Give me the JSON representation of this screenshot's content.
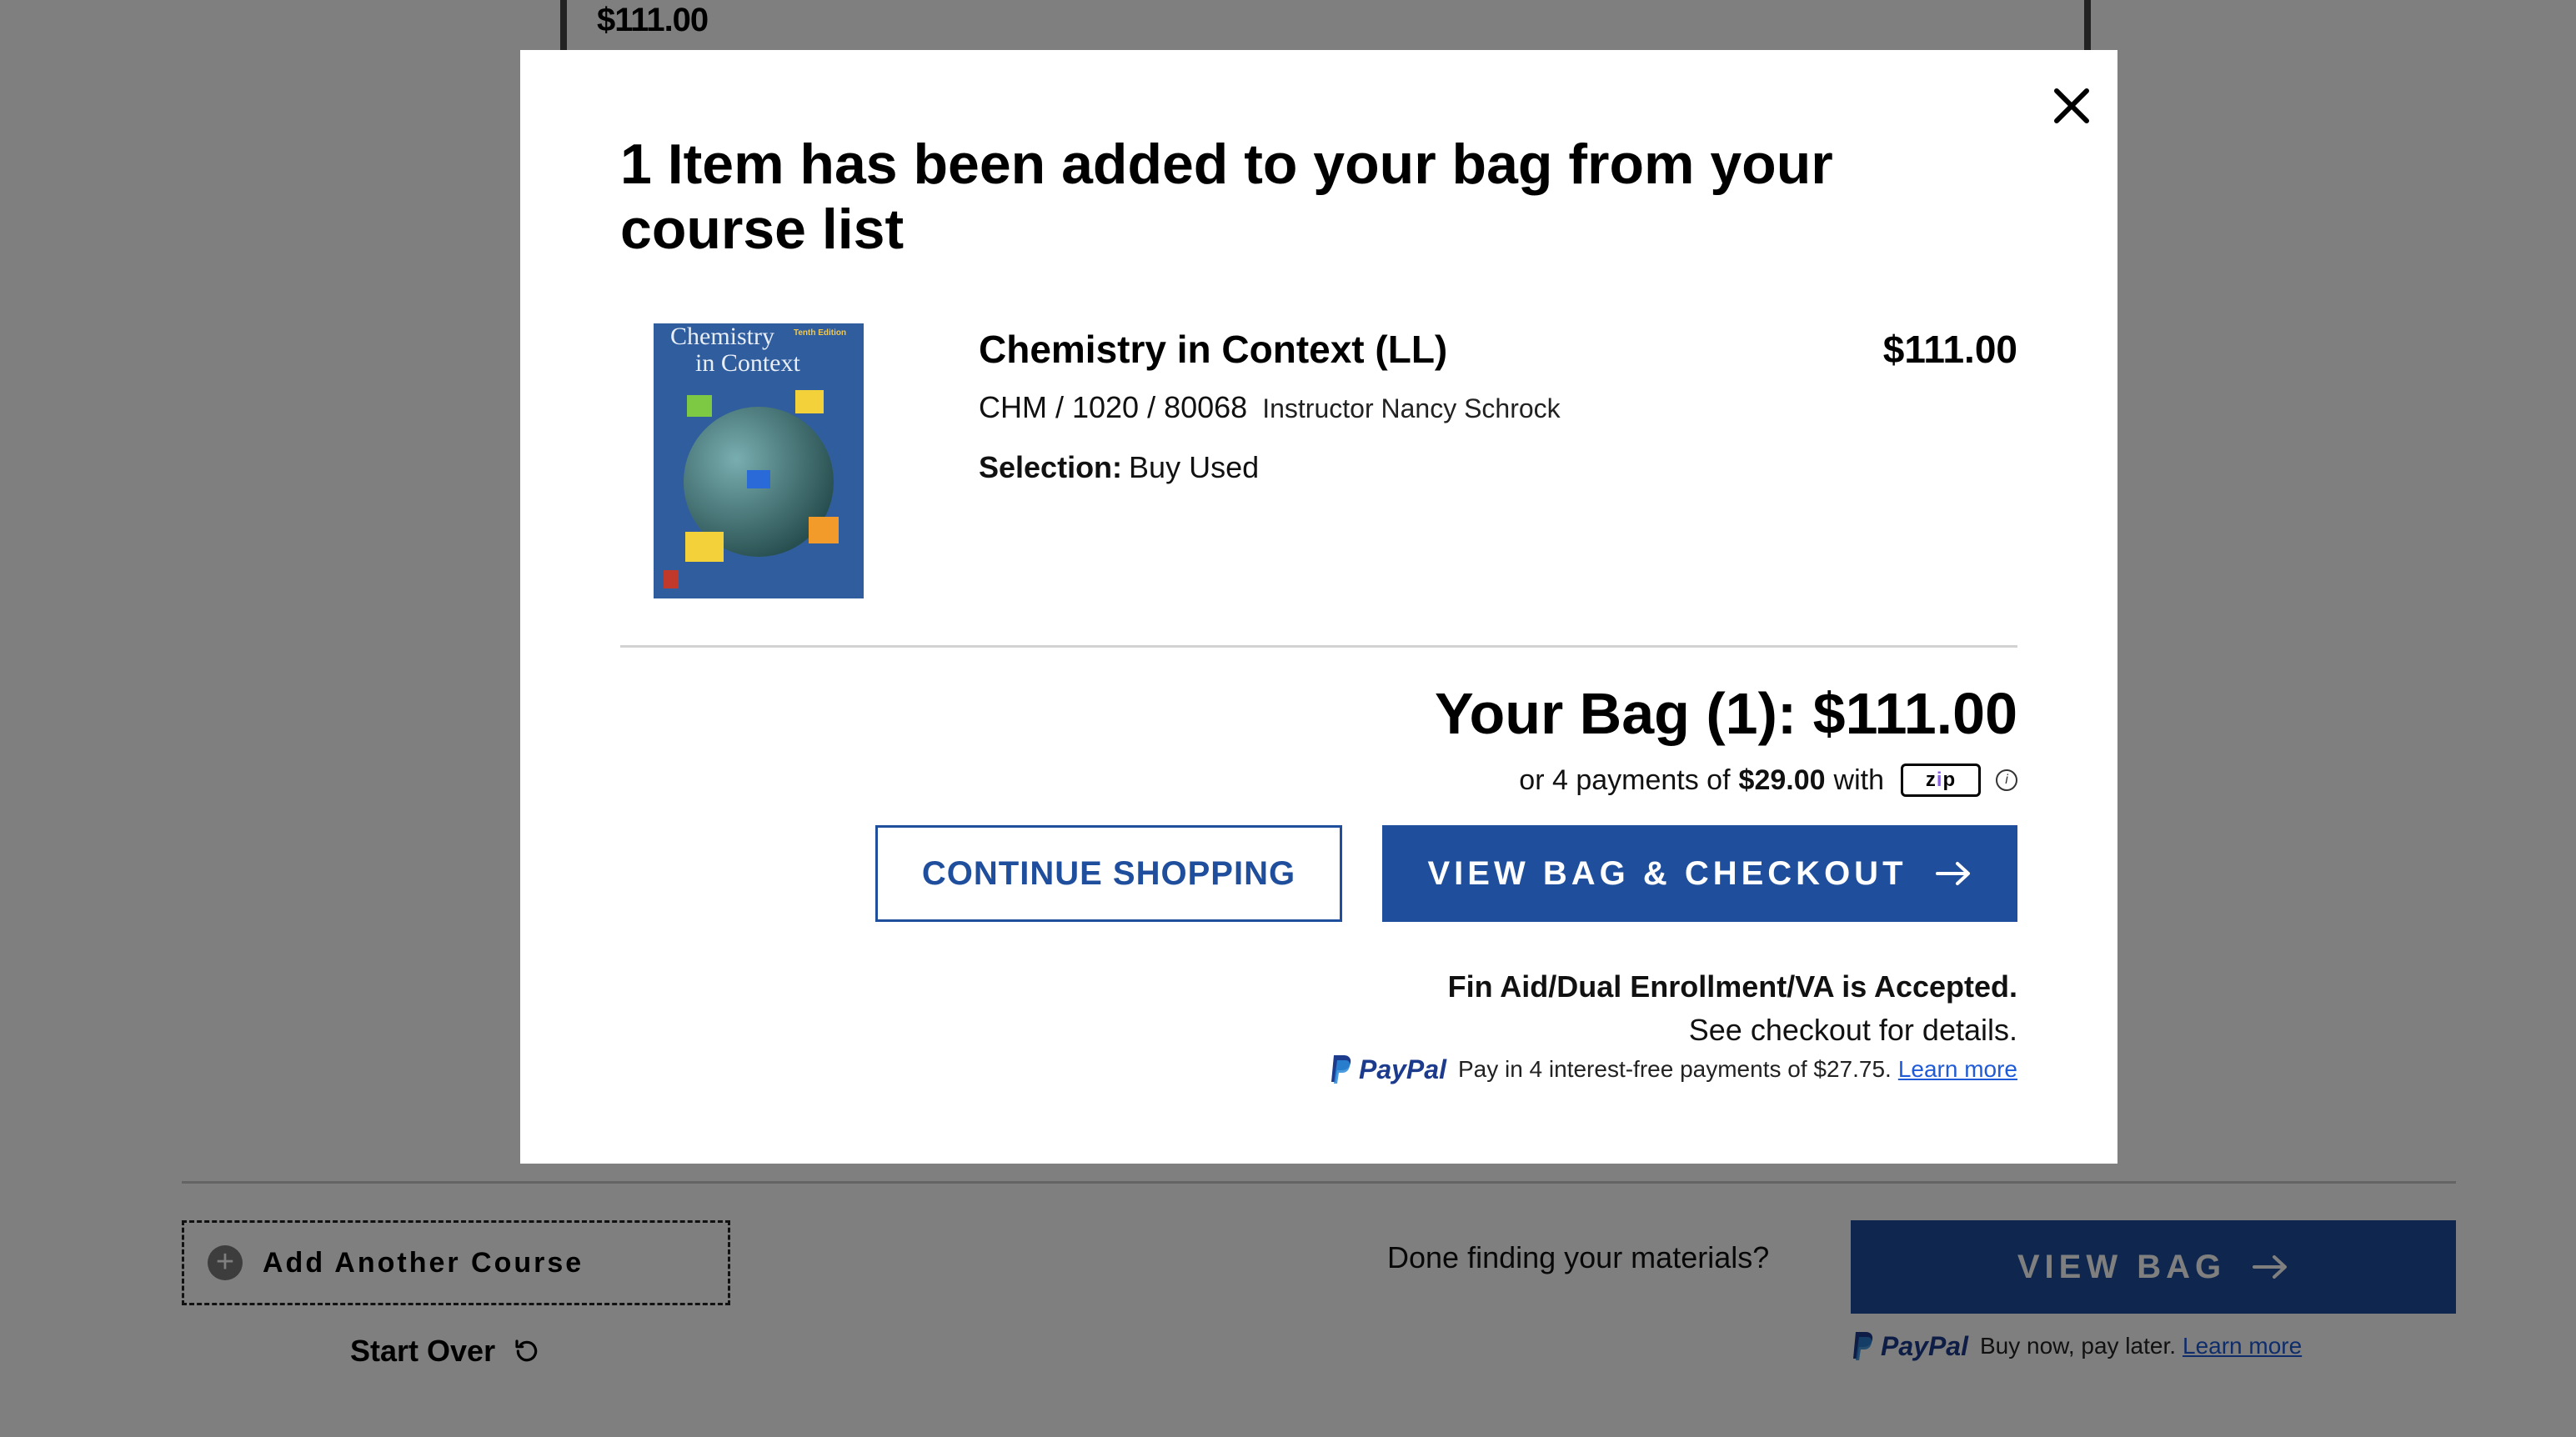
{
  "background": {
    "top_price": "$111.00",
    "add_course_label": "Add Another Course",
    "start_over_label": "Start Over",
    "done_prompt": "Done finding your materials?",
    "view_bag_label": "VIEW BAG",
    "paypal": {
      "brand": "PayPal",
      "text": "Buy now, pay later.",
      "link": "Learn more"
    }
  },
  "modal": {
    "title": "1 Item has been added to your bag from your course list",
    "product": {
      "title": "Chemistry in Context (LL)",
      "price": "$111.00",
      "course": "CHM / 1020 / 80068",
      "instructor": "Instructor Nancy Schrock",
      "selection_label": "Selection:",
      "selection_value": "Buy Used",
      "cover": {
        "title_line1": "Chemistry",
        "title_line2": "in Context",
        "edition": "Tenth Edition"
      }
    },
    "bag_total": "Your Bag (1): $111.00",
    "installments": {
      "prefix": "or 4 payments of",
      "amount": "$29.00",
      "suffix": "with",
      "provider": "zip",
      "info_icon": "info-icon"
    },
    "continue_label": "CONTINUE SHOPPING",
    "checkout_label": "VIEW BAG & CHECKOUT",
    "fin_aid": "Fin Aid/Dual Enrollment/VA is Accepted.",
    "fin_aid_detail": "See checkout for details.",
    "paypal": {
      "brand": "PayPal",
      "text": "Pay in 4 interest-free payments of $27.75.",
      "link": "Learn more"
    }
  },
  "colors": {
    "primary": "#1f4e9c",
    "overlay": "rgba(0,0,0,0.5)",
    "link": "#1f5bd6"
  }
}
